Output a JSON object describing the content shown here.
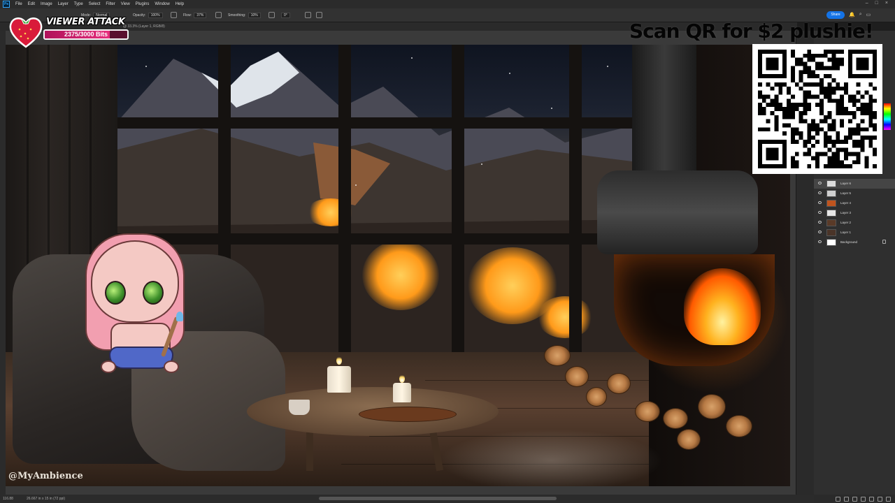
{
  "menubar": {
    "app_icon": "photoshop-logo",
    "items": [
      "File",
      "Edit",
      "Image",
      "Layer",
      "Type",
      "Select",
      "Filter",
      "View",
      "Plugins",
      "Window",
      "Help"
    ]
  },
  "options": {
    "mode_label": "Mode:",
    "mode_value": "Normal",
    "opacity_label": "Opacity:",
    "opacity_value": "100%",
    "flow_label": "Flow:",
    "flow_value": "37%",
    "smoothing_label": "Smoothing:",
    "smoothing_value": "10%",
    "angle_value": "0°",
    "share_label": "Share"
  },
  "document": {
    "tab_label": "@ 33.3% (Layer 1, RGB/8)",
    "zoom_level": "116.88",
    "size_info": "26.667 in x 15 in (72 ppi)"
  },
  "layers": [
    {
      "name": "Layer 6",
      "selected": true,
      "locked": false
    },
    {
      "name": "Layer 5",
      "selected": false,
      "locked": false
    },
    {
      "name": "Layer 4",
      "selected": false,
      "locked": false
    },
    {
      "name": "Layer 3",
      "selected": false,
      "locked": false
    },
    {
      "name": "Layer 2",
      "selected": false,
      "locked": false
    },
    {
      "name": "Layer 1",
      "selected": false,
      "locked": false
    },
    {
      "name": "Background",
      "selected": false,
      "locked": true
    }
  ],
  "overlay": {
    "viewer_attack_title": "VIEWER ATTACK",
    "bits_progress": "2375/3000 Bits",
    "bits_fraction": 0.7917,
    "qr_headline": "Scan QR for $2 plushie!",
    "watermark": "@MyAmbience"
  },
  "colors": {
    "accent": "#1473e6",
    "bits_fill": "#e62e7c",
    "bits_bg": "#5a0f2e"
  }
}
